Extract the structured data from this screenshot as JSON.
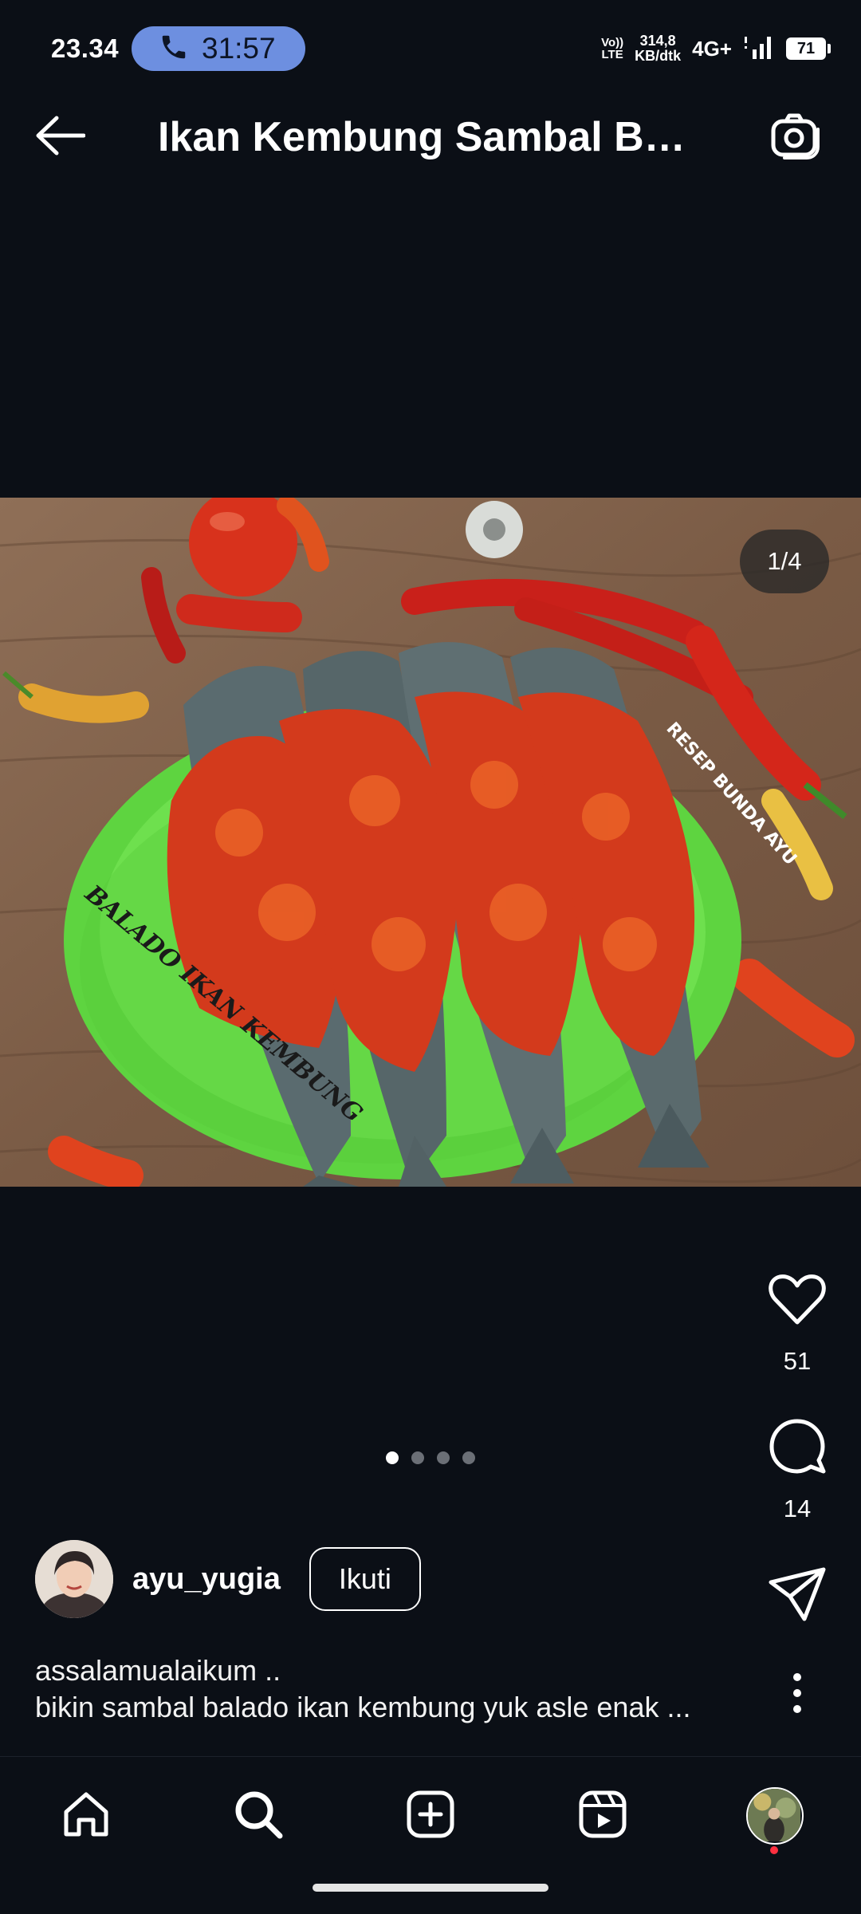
{
  "status_bar": {
    "time": "23.34",
    "call_duration": "31:57",
    "volte_line1": "Vo))",
    "volte_line2": "LTE",
    "speed_value": "314,8",
    "speed_unit": "KB/dtk",
    "network_type": "4G+",
    "battery_level": "71"
  },
  "header": {
    "title": "Ikan Kembung Sambal Bal...",
    "back_icon": "arrow-left-icon",
    "camera_icon": "camera-icon"
  },
  "post": {
    "image_counter": "1/4",
    "current_image": 1,
    "total_images": 4,
    "image_overlay_text_1": "RESEP BUNDA AYU",
    "image_overlay_text_2": "BALADO IKAN KEMBUNG",
    "likes": "51",
    "comments": "14",
    "author": "ayu_yugia",
    "follow_label": "Ikuti",
    "caption_line1": "assalamualaikum ..",
    "caption_line2": "bikin sambal balado ikan kembung yuk asle enak ..."
  },
  "actions": {
    "like_icon": "heart-icon",
    "comment_icon": "comment-icon",
    "share_icon": "send-icon",
    "more_icon": "more-vertical-icon"
  },
  "nav": {
    "items": [
      "home-icon",
      "search-icon",
      "create-icon",
      "reels-icon",
      "profile-avatar"
    ]
  },
  "colors": {
    "background": "#0b0f16",
    "call_pill": "#6d8fe0",
    "notification_dot": "#ff3040",
    "plate_green": "#6ee04e"
  }
}
